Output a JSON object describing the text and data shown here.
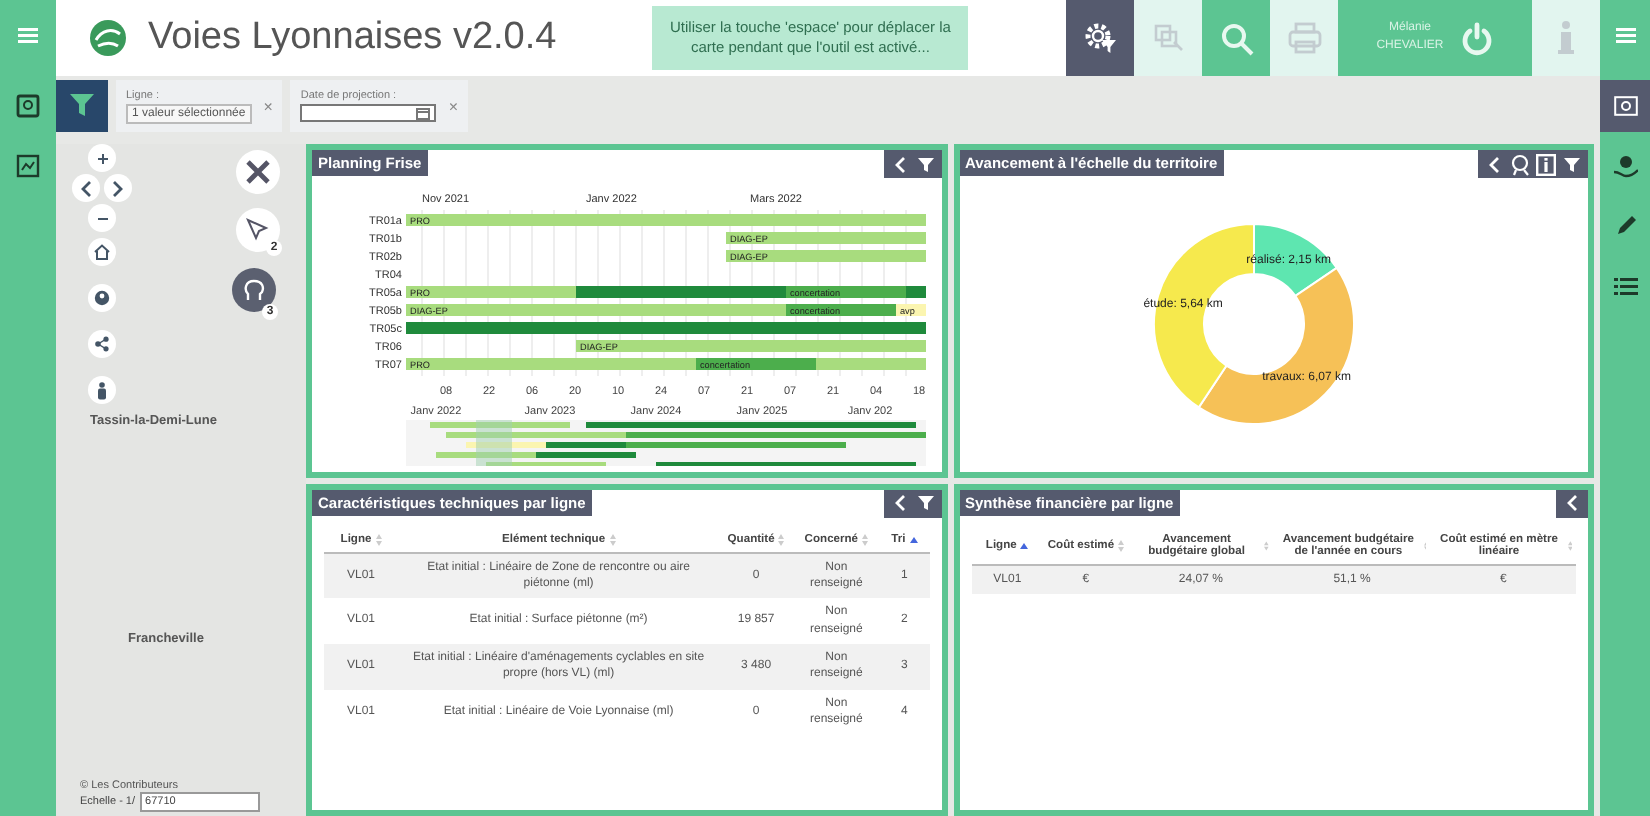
{
  "app": {
    "title": "Voies Lyonnaises v2.0.4",
    "hint": "Utiliser la touche 'espace' pour déplacer la carte pendant que l'outil est activé...",
    "user_first_name": "Mélanie",
    "user_last_name": "CHEVALIER"
  },
  "toolbar": [
    {
      "kind": "settings",
      "selected": true,
      "disabled": false
    },
    {
      "kind": "layers",
      "selected": false,
      "disabled": true
    },
    {
      "kind": "search",
      "selected": false,
      "disabled": false
    },
    {
      "kind": "print",
      "selected": false,
      "disabled": true
    },
    {
      "kind": "user",
      "selected": false,
      "disabled": false
    },
    {
      "kind": "info",
      "selected": false,
      "disabled": true
    }
  ],
  "filters": [
    {
      "kind": "select",
      "label": "Ligne :",
      "value": "1 valeur sélectionnée",
      "clear": "×"
    },
    {
      "kind": "date",
      "label": "Date de projection :",
      "clear": "×"
    }
  ],
  "map": {
    "labels": [
      "Tassin-la-Demi-Lune",
      "Francheville"
    ],
    "badges": [
      "2",
      "3"
    ],
    "attribution": "© Les Contributeurs",
    "scale_label": "Echelle - 1/",
    "scale_value": "67710"
  },
  "planning": {
    "title": "Planning Frise",
    "months": [
      "Nov 2021",
      "Janv 2022",
      "Mars 2022"
    ],
    "days": [
      "08",
      "22",
      "06",
      "20",
      "10",
      "24",
      "07",
      "21",
      "07",
      "21",
      "04",
      "18"
    ],
    "overview_years": [
      "Janv 2022",
      "Janv 2023",
      "Janv 2024",
      "Janv 2025",
      "Janv 202"
    ],
    "rows": [
      {
        "label": "TR01a",
        "tasks": [
          "PRO"
        ]
      },
      {
        "label": "TR01b",
        "tasks": [
          "DIAG-EP"
        ]
      },
      {
        "label": "TR02b",
        "tasks": [
          "DIAG-EP"
        ]
      },
      {
        "label": "TR04",
        "tasks": []
      },
      {
        "label": "TR05a",
        "tasks": [
          "PRO",
          "concertation"
        ]
      },
      {
        "label": "TR05b",
        "tasks": [
          "DIAG-EP",
          "concertation",
          "avp"
        ]
      },
      {
        "label": "TR05c",
        "tasks": []
      },
      {
        "label": "TR06",
        "tasks": [
          "DIAG-EP"
        ]
      },
      {
        "label": "TR07",
        "tasks": [
          "PRO",
          "concertation"
        ]
      }
    ]
  },
  "progress": {
    "title": "Avancement à l'échelle du territoire",
    "chart_data": {
      "type": "donut",
      "categories": [
        "réalisé",
        "travaux",
        "étude"
      ],
      "values": [
        2.15,
        6.07,
        5.64
      ],
      "colors": [
        "#5ee6b0",
        "#f6c157",
        "#f6e94d"
      ],
      "value_labels": [
        "2,15 km",
        "6,07 km",
        "5,64 km"
      ]
    }
  },
  "technical": {
    "title": "Caractéristiques techniques par ligne",
    "columns": [
      {
        "label": "Ligne",
        "sorted": false
      },
      {
        "label": "Elément technique",
        "sorted": false
      },
      {
        "label": "Quantité",
        "sorted": false
      },
      {
        "label": "Concerné",
        "sorted": false
      },
      {
        "label": "Tri",
        "sorted": true
      }
    ],
    "rows": [
      [
        "VL01",
        "Etat initial : Linéaire de Zone de rencontre ou aire piétonne (ml)",
        "0",
        "Non renseigné",
        "1"
      ],
      [
        "VL01",
        "Etat initial : Surface piétonne (m²)",
        "19 857",
        "Non renseigné",
        "2"
      ],
      [
        "VL01",
        "Etat initial : Linéaire d'aménagements cyclables en site propre (hors VL) (ml)",
        "3 480",
        "Non renseigné",
        "3"
      ],
      [
        "VL01",
        "Etat initial : Linéaire de Voie Lyonnaise (ml)",
        "0",
        "Non renseigné",
        "4"
      ]
    ]
  },
  "finance": {
    "title": "Synthèse financière par ligne",
    "columns": [
      {
        "label": "Ligne",
        "sorted": true
      },
      {
        "label": "Coût estimé",
        "sorted": false
      },
      {
        "label": "Avancement budgétaire global",
        "sorted": false
      },
      {
        "label": "Avancement budgétaire de l'année en cours",
        "sorted": false
      },
      {
        "label": "Coût estimé en mètre linéaire",
        "sorted": false
      }
    ],
    "rows": [
      [
        "VL01",
        "€",
        "24,07 %",
        "51,1 %",
        "€"
      ]
    ]
  }
}
